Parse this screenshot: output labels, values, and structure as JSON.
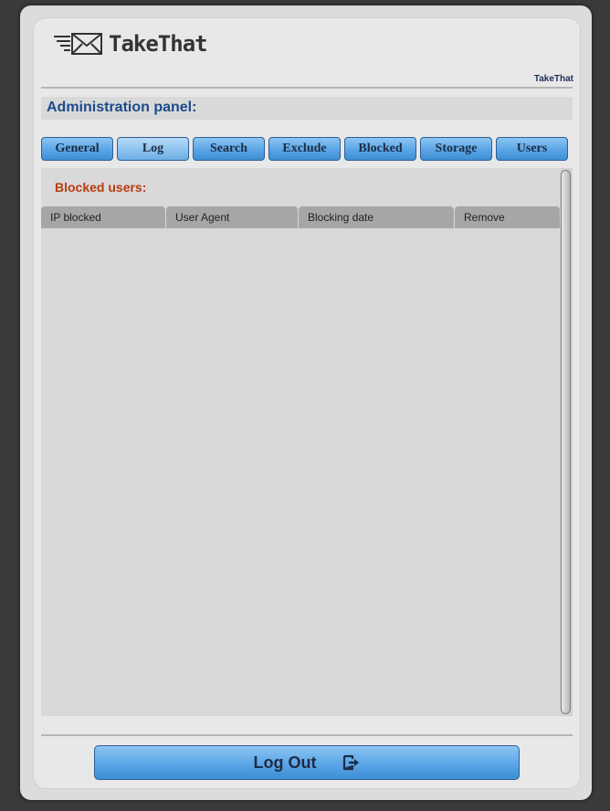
{
  "header": {
    "logo_text": "TakeThat",
    "brand_small": "TakeThat"
  },
  "panel": {
    "title": "Administration panel:"
  },
  "tabs": [
    {
      "label": "General"
    },
    {
      "label": "Log",
      "active": true
    },
    {
      "label": "Search"
    },
    {
      "label": "Exclude"
    },
    {
      "label": "Blocked"
    },
    {
      "label": "Storage"
    },
    {
      "label": "Users"
    }
  ],
  "blocked": {
    "title": "Blocked users:",
    "columns": [
      "IP blocked",
      "User Agent",
      "Blocking date",
      "Remove"
    ],
    "rows": []
  },
  "footer": {
    "logout_label": "Log Out"
  },
  "icons": {
    "logo": "envelope-speed-icon",
    "logout": "logout-icon"
  }
}
